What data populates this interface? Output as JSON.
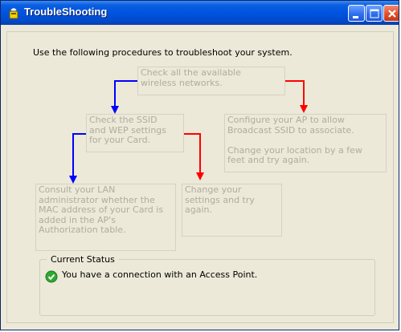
{
  "window": {
    "title": "TroubleShooting"
  },
  "intro": "Use the following procedures to troubleshoot your system.",
  "steps": {
    "check_networks": "Check all the available\nwireless networks.",
    "check_ssid": "Check the SSID\nand WEP settings\nfor your Card.",
    "configure_ap": "Configure your AP to allow\nBroadcast SSID to associate.\n\nChange your location by a few\nfeet and try again.",
    "consult_admin": "Consult your LAN\nadministrator whether the\nMAC address of your Card is\nadded in the AP's\nAuthorization table.",
    "change_settings": "Change your\nsettings and try\nagain."
  },
  "status": {
    "legend": "Current Status",
    "message": "You have a connection with an Access Point."
  },
  "colors": {
    "blue_arrow": "#0000ff",
    "red_arrow": "#ff0000",
    "titlebar": "#0053e0"
  },
  "icons": {
    "title": "wireless-icon",
    "status": "green-check-icon"
  }
}
